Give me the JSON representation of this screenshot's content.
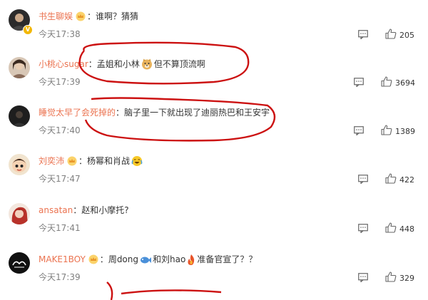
{
  "comments": [
    {
      "username": "书生聊娱",
      "text": "谁啊？猜猜",
      "time": "今天17:38",
      "likes": "205",
      "has_crown": true,
      "has_vbadge": true,
      "avatar": "dark-portrait-avatar"
    },
    {
      "username": "小桃心sugar",
      "text": "孟姐和小林",
      "emoji": "doge-emoji",
      "text_after": "但不算顶流啊",
      "time": "今天17:39",
      "likes": "3694",
      "has_crown": false,
      "avatar": "portrait-avatar"
    },
    {
      "username": "睡觉太早了会死掉的",
      "text": "脑子里一下就出现了迪丽热巴和王安宇",
      "time": "今天17:40",
      "likes": "1389",
      "has_crown": false,
      "avatar": "dark-avatar"
    },
    {
      "username": "刘奕沛",
      "text": "杨幂和肖战",
      "emoji": "laugh-cry-emoji",
      "time": "今天17:47",
      "likes": "422",
      "has_crown": true,
      "avatar": "cartoon-avatar"
    },
    {
      "username": "ansatan",
      "text": "赵和小摩托?",
      "time": "今天17:41",
      "likes": "448",
      "has_crown": false,
      "avatar": "red-hair-avatar"
    },
    {
      "username": "MAKE1BOY",
      "text": "周dong",
      "emoji": "fish-emoji",
      "text_mid": "和刘hao",
      "emoji2": "fire-emoji",
      "text_after": "准备官宣了？？",
      "time": "今天17:39",
      "likes": "329",
      "has_crown": true,
      "avatar": "logo-avatar"
    }
  ],
  "colors": {
    "username": "#eb7350",
    "scribble": "#cc1111",
    "time": "#808080"
  }
}
